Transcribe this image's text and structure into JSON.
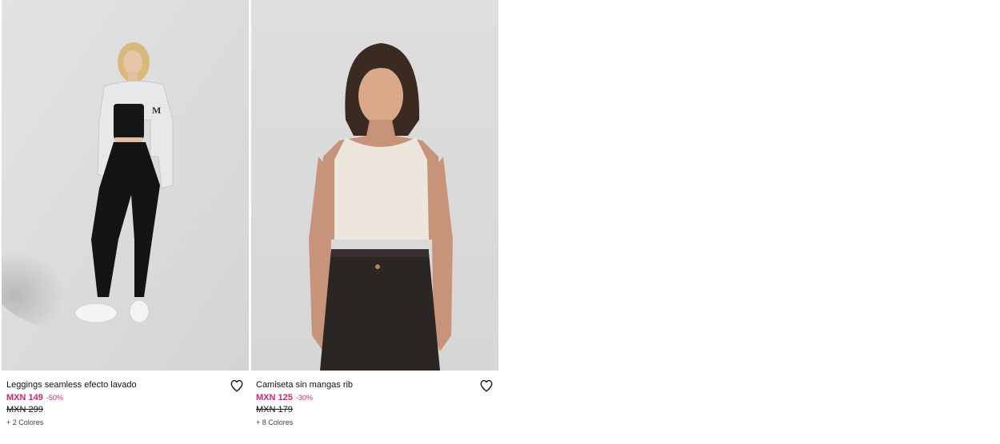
{
  "products": [
    {
      "name": "Leggings seamless efecto lavado",
      "price": "MXN 149",
      "discount": "-50%",
      "old_price": "MXN 299",
      "colors": "+ 2 Colores",
      "favorite_icon": "heart-outline-icon"
    },
    {
      "name": "Camiseta sin mangas rib",
      "price": "MXN 125",
      "discount": "-30%",
      "old_price": "MXN 179",
      "colors": "+ 8 Colores",
      "favorite_icon": "heart-outline-icon"
    }
  ],
  "colors": {
    "sale_price": "#d6246e",
    "text": "#111111",
    "image_background": "#dcdcdc"
  }
}
